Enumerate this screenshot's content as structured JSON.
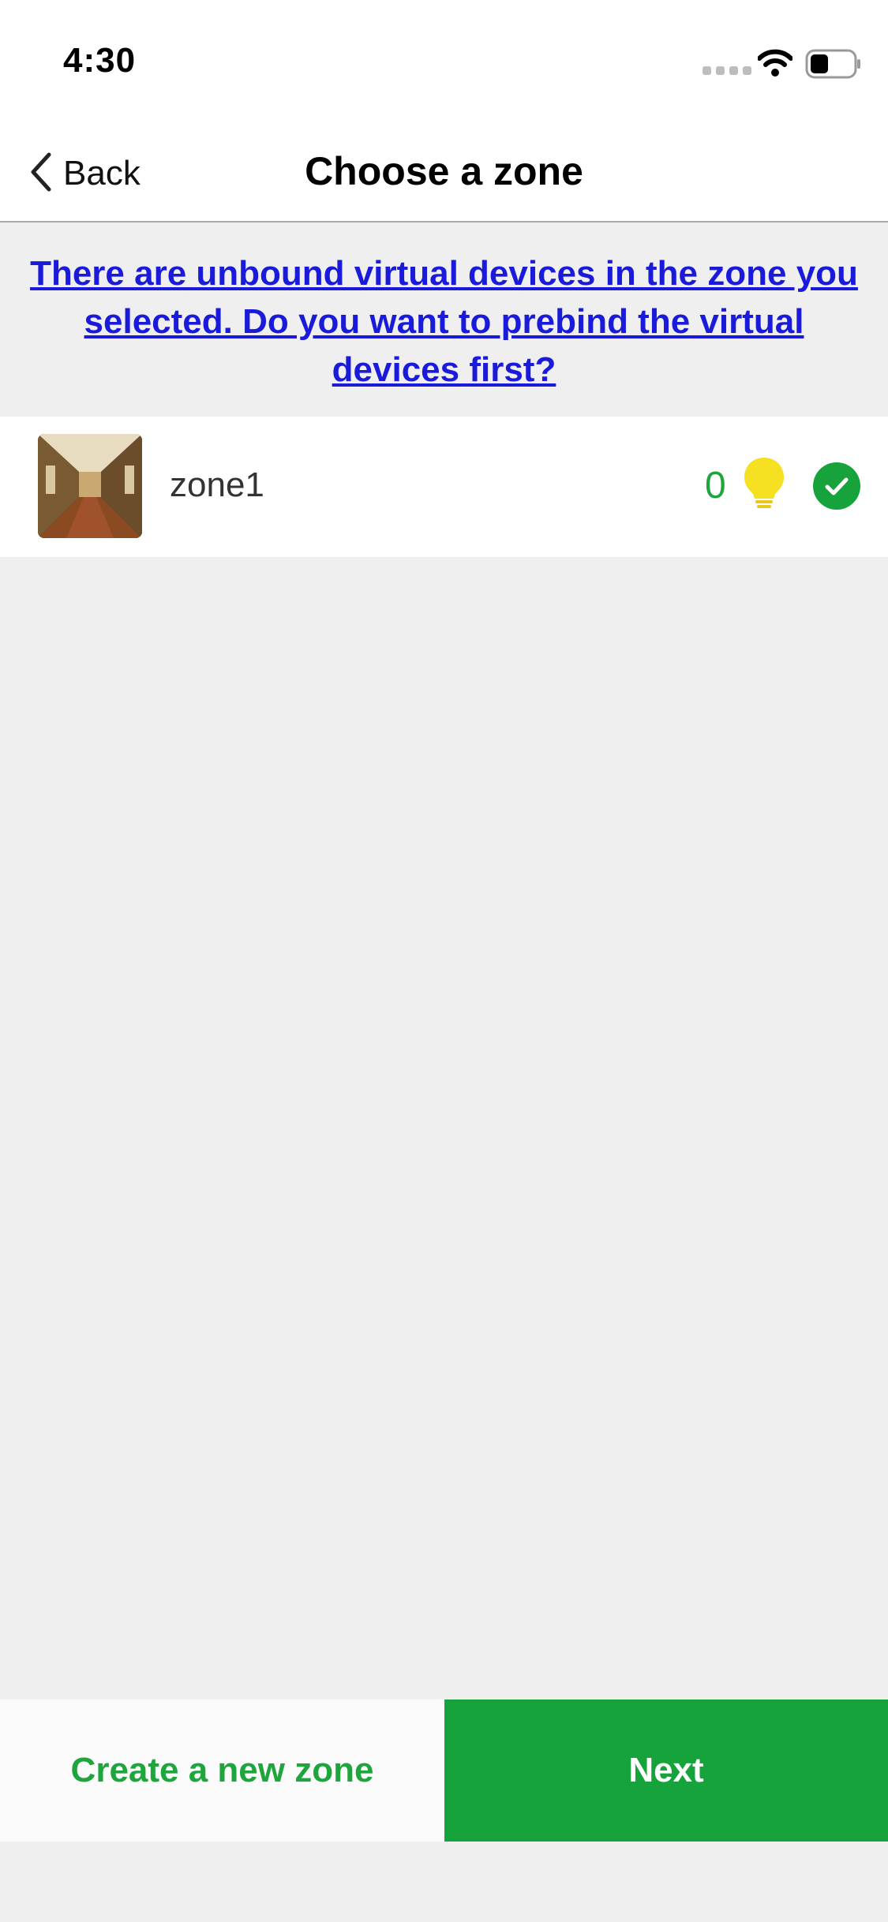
{
  "status_bar": {
    "time": "4:30",
    "icons": [
      "signal-icon",
      "wifi-icon",
      "battery-icon"
    ]
  },
  "navbar": {
    "back_label": "Back",
    "back_icon": "chevron-left-icon",
    "title": "Choose a zone"
  },
  "notice": {
    "text": "There are unbound virtual devices in the zone you selected. Do you want to prebind the virtual devices first?"
  },
  "zones": [
    {
      "name": "zone1",
      "device_count": "0",
      "device_icon": "lightbulb-icon",
      "selected": true,
      "selected_icon": "check-circle-icon"
    }
  ],
  "footer": {
    "create_label": "Create a new zone",
    "next_label": "Next"
  },
  "colors": {
    "accent_green": "#17a33b",
    "link_blue": "#1a1adb",
    "bulb_yellow": "#f5e021",
    "background": "#efefef"
  }
}
